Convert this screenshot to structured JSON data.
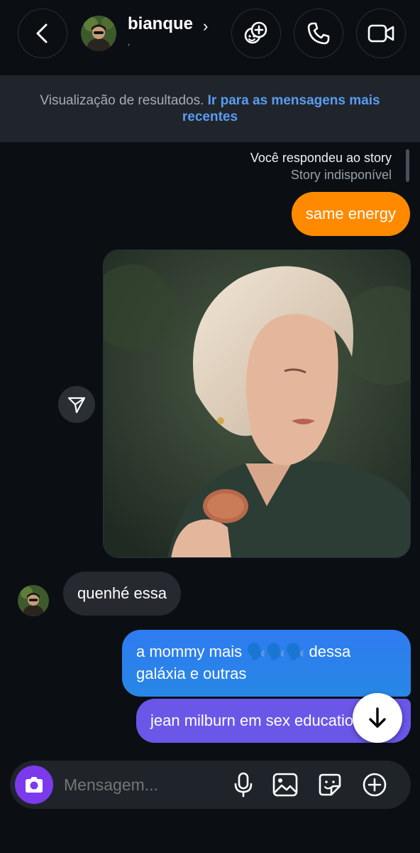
{
  "header": {
    "username": "bianque",
    "chevron": "›",
    "subtitle": "‚",
    "icons": {
      "back": "chevron-left-icon",
      "effects": "effects-icon",
      "call": "phone-icon",
      "video": "video-camera-icon"
    }
  },
  "banner": {
    "text": "Visualização de resultados. ",
    "link": "Ir para as mensagens mais recentes"
  },
  "story_note": {
    "line1": "Você respondeu ao story",
    "line2": "Story indisponível"
  },
  "messages": {
    "sent_orange": "same energy",
    "received": "quenhé essa",
    "sent_blue": "a mommy mais 🗣️🗣️🗣️ dessa galáxia e outras",
    "sent_purple": "jean milburn em sex education"
  },
  "composer": {
    "placeholder": "Mensagem..."
  },
  "colors": {
    "background": "#0b0f14",
    "orange_bubble": "#ff8a00",
    "blue_bubble": "#2f7bf0",
    "purple_bubble": "#6a57e8",
    "received_bubble": "#262a30",
    "camera_button": "#7c3aed",
    "link": "#5a9cf0"
  }
}
